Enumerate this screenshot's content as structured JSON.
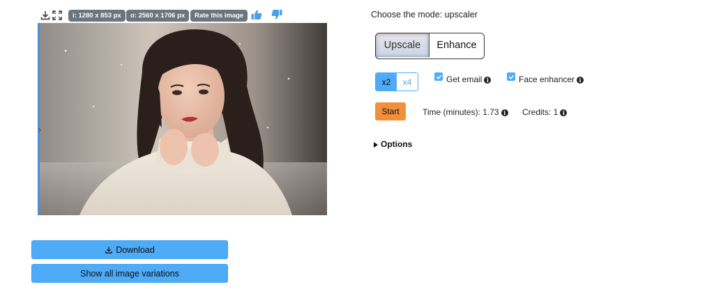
{
  "toolbar": {
    "input_size": "i: 1280 x 853 px",
    "output_size": "o: 2560 x 1706 px",
    "rate_label": "Rate this image",
    "icons": [
      "download-icon",
      "fullscreen-icon",
      "thumbs-up-icon",
      "thumbs-down-icon"
    ]
  },
  "image": {
    "subject": "woman-in-white-coat-snow"
  },
  "actions": {
    "download_label": "Download",
    "variations_label": "Show all image variations"
  },
  "mode": {
    "label": "Choose the mode: upscaler",
    "options": [
      "Upscale",
      "Enhance"
    ],
    "selected": "Upscale"
  },
  "scale": {
    "options": [
      "x2",
      "x4"
    ],
    "selected": "x2"
  },
  "checks": {
    "email_label": "Get email",
    "face_label": "Face enhancer",
    "email_checked": true,
    "face_checked": true
  },
  "run": {
    "start_label": "Start",
    "time_text": "Time (minutes): 1.73",
    "credits_text": "Credits: 1"
  },
  "options": {
    "label": "Options"
  },
  "colors": {
    "accent": "#4dabf7",
    "start": "#f0903a",
    "pill": "#6c757d"
  }
}
